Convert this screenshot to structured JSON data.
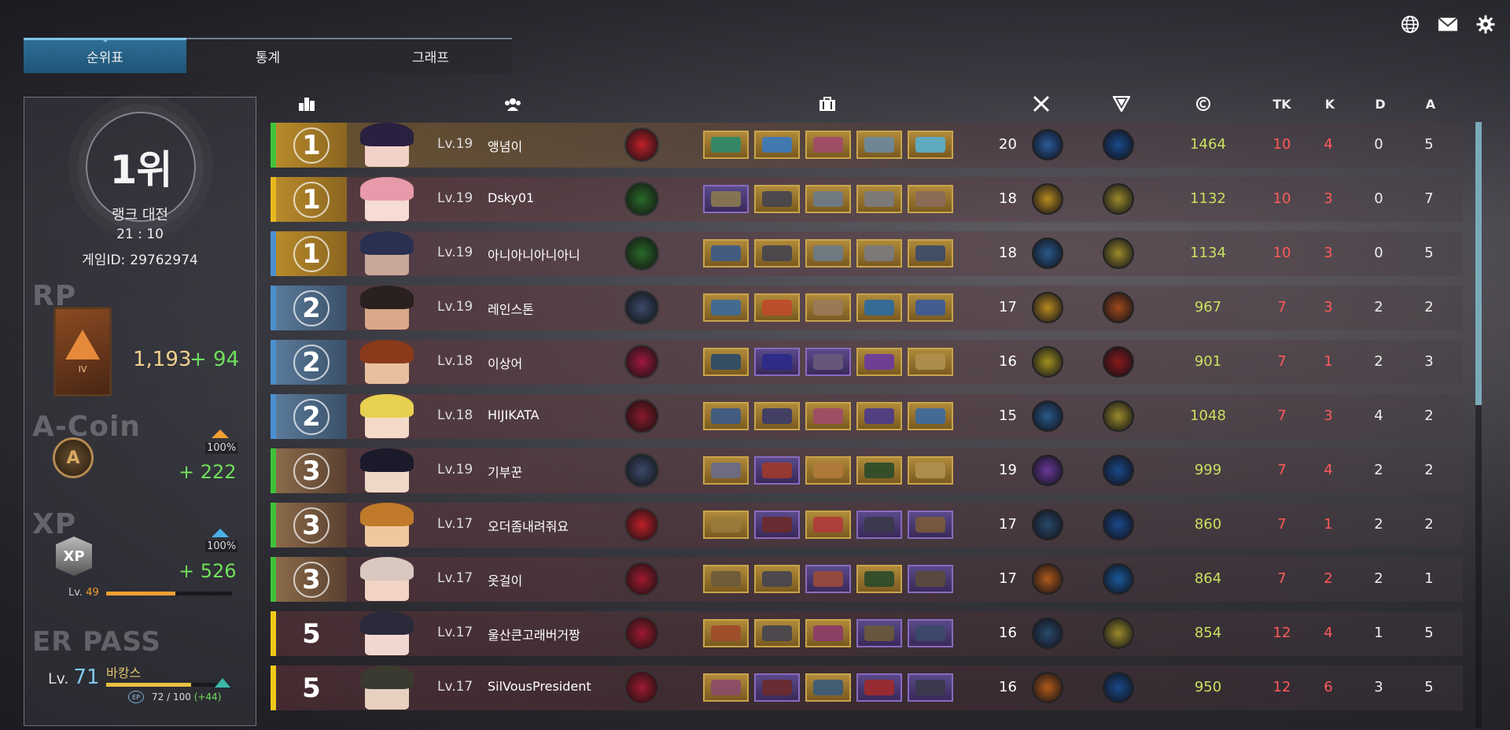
{
  "tabs": [
    {
      "label": "순위표",
      "active": true
    },
    {
      "label": "통계",
      "active": false
    },
    {
      "label": "그래프",
      "active": false
    }
  ],
  "top_icons": [
    "globe-icon",
    "mail-icon",
    "gear-icon"
  ],
  "summary": {
    "rank": "1위",
    "mode": "랭크 대전",
    "time": "21 : 10",
    "game_id_label": "게임ID:",
    "game_id": "29762974",
    "rp_label": "RP",
    "rp_tier": "IV",
    "rp_value": "1,193",
    "rp_gain": "+ 94",
    "acoin_label": "A-Coin",
    "acoin_pct": "100%",
    "acoin_gain": "+ 222",
    "xp_label": "XP",
    "xp_icon_text": "XP",
    "xp_pct": "100%",
    "xp_gain": "+ 526",
    "xp_level_prefix": "Lv.",
    "xp_level": "49",
    "xp_progress": 0.55,
    "erpass_label": "ER PASS",
    "er_level_prefix": "Lv.",
    "er_level": "71",
    "er_name": "바캉스",
    "ep_badge": "EP",
    "ep_value": "72 / 100",
    "ep_gain": "(+44)",
    "ep_progress": 0.72
  },
  "columns": [
    "rank-icon",
    "team-icon",
    "inventory-icon",
    "weapon-mastery-icon",
    "trait-icon",
    "credit-icon",
    "TK",
    "K",
    "D",
    "A"
  ],
  "colors": {
    "green": "#3fc23a",
    "gold": "#e8b820",
    "blue": "#4a90d0",
    "yellow": "#f0c81a",
    "credit": "#c9e060",
    "kill": "#ff5a5a"
  },
  "rows": [
    {
      "rank": "1",
      "stripe": "green",
      "tint": "rgba(150,110,40,0.55)",
      "level": "Lv.19",
      "name": "앵념이",
      "weapon_lv": "20",
      "credit": "1464",
      "tk": "10",
      "k": "4",
      "d": "0",
      "a": "5",
      "skill": "#c0202a",
      "weapon": "#2a5a9a",
      "trait": "#1a4a8a",
      "items": [
        "#2a8a6a",
        "#3a7ac0",
        "#a04a6a",
        "#6a8aa0",
        "#5ab0d0"
      ],
      "item_borders": [
        "#c9a44a",
        "#c9a44a",
        "#c9a44a",
        "#c9a44a",
        "#c9a44a"
      ],
      "hair": "#2a2040",
      "skin_tone": "#f2d2c8"
    },
    {
      "rank": "1",
      "stripe": "gold",
      "tint": "rgba(120,60,60,0.45)",
      "level": "Lv.19",
      "name": "Dsky01",
      "weapon_lv": "18",
      "credit": "1132",
      "tk": "10",
      "k": "3",
      "d": "0",
      "a": "7",
      "skill": "#2a6a2a",
      "weapon": "#b88a20",
      "trait": "#9a8a2a",
      "items": [
        "#8a7a50",
        "#444450",
        "#6a7a8a",
        "#7a7a80",
        "#8a6a5a"
      ],
      "item_borders": [
        "#8a6ac0",
        "#c9a44a",
        "#c9a44a",
        "#c9a44a",
        "#c9a44a"
      ],
      "hair": "#e89aaa",
      "skin_tone": "#f6dcd2"
    },
    {
      "rank": "1",
      "stripe": "blue",
      "tint": "rgba(110,60,70,0.45)",
      "level": "Lv.19",
      "name": "아니아니아니아니",
      "weapon_lv": "18",
      "credit": "1134",
      "tk": "10",
      "k": "3",
      "d": "0",
      "a": "5",
      "skill": "#2a6a2a",
      "weapon": "#2a5a8a",
      "trait": "#9a8a2a",
      "items": [
        "#3a5a8a",
        "#444450",
        "#6a7a8a",
        "#7a7a80",
        "#3a4a6a"
      ],
      "item_borders": [
        "#c9a44a",
        "#c9a44a",
        "#c9a44a",
        "#c9a44a",
        "#c9a44a"
      ],
      "hair": "#2a3050",
      "skin_tone": "#c8a898"
    },
    {
      "rank": "2",
      "stripe": "blue",
      "tint": "rgba(110,55,60,0.45)",
      "level": "Lv.19",
      "name": "레인스톤",
      "weapon_lv": "17",
      "credit": "967",
      "tk": "7",
      "k": "3",
      "d": "2",
      "a": "2",
      "skill": "#3a4a6a",
      "weapon": "#b88a20",
      "trait": "#a04a1a",
      "items": [
        "#3a6a9a",
        "#c04a2a",
        "#9a7a5a",
        "#2a6aa0",
        "#3a5a9a"
      ],
      "item_borders": [
        "#c9a44a",
        "#c9a44a",
        "#c9a44a",
        "#c9a44a",
        "#c9a44a"
      ],
      "hair": "#2a2020",
      "skin_tone": "#d8a888"
    },
    {
      "rank": "2",
      "stripe": "blue",
      "tint": "rgba(110,55,60,0.45)",
      "level": "Lv.18",
      "name": "이상어",
      "weapon_lv": "16",
      "credit": "901",
      "tk": "7",
      "k": "1",
      "d": "2",
      "a": "3",
      "skill": "#a01a40",
      "weapon": "#a09020",
      "trait": "#8a1a1a",
      "items": [
        "#2a4a6a",
        "#2a2a8a",
        "#6a5a7a",
        "#6a3aa0",
        "#b09050"
      ],
      "item_borders": [
        "#c9a44a",
        "#8a6ac0",
        "#8a6ac0",
        "#c9a44a",
        "#c9a44a"
      ],
      "hair": "#8a3a1a",
      "skin_tone": "#e8c0a0"
    },
    {
      "rank": "2",
      "stripe": "blue",
      "tint": "rgba(110,55,60,0.45)",
      "level": "Lv.18",
      "name": "HIJIKATA",
      "weapon_lv": "15",
      "credit": "1048",
      "tk": "7",
      "k": "3",
      "d": "4",
      "a": "2",
      "skill": "#8a1a2a",
      "weapon": "#2a5a8a",
      "trait": "#9a8a2a",
      "items": [
        "#3a5a8a",
        "#3a3a6a",
        "#a04a6a",
        "#4a3a8a",
        "#3a6aa0"
      ],
      "item_borders": [
        "#c9a44a",
        "#c9a44a",
        "#c9a44a",
        "#c9a44a",
        "#c9a44a"
      ],
      "hair": "#e8d050",
      "skin_tone": "#f4dac8"
    },
    {
      "rank": "3",
      "stripe": "green",
      "tint": "rgba(110,55,60,0.45)",
      "level": "Lv.19",
      "name": "기부꾼",
      "weapon_lv": "19",
      "credit": "999",
      "tk": "7",
      "k": "4",
      "d": "2",
      "a": "2",
      "skill": "#3a4a6a",
      "weapon": "#6a3a9a",
      "trait": "#1a4a8a",
      "items": [
        "#6a6a8a",
        "#a03a2a",
        "#b07a3a",
        "#2a4a2a",
        "#b09050"
      ],
      "item_borders": [
        "#c9a44a",
        "#8a6ac0",
        "#c9a44a",
        "#c9a44a",
        "#c9a44a"
      ],
      "hair": "#1a1a2a",
      "skin_tone": "#f0d8c8"
    },
    {
      "rank": "3",
      "stripe": "green",
      "tint": "rgba(110,55,60,0.45)",
      "level": "Lv.17",
      "name": "오더좀내려줘요",
      "weapon_lv": "17",
      "credit": "860",
      "tk": "7",
      "k": "1",
      "d": "2",
      "a": "2",
      "skill": "#c0202a",
      "weapon": "#2a4a6a",
      "trait": "#1a4a8a",
      "items": [
        "#9a7a3a",
        "#6a2a2a",
        "#b03a3a",
        "#3a3a4a",
        "#7a5a3a"
      ],
      "item_borders": [
        "#c9a44a",
        "#8a6ac0",
        "#c9a44a",
        "#8a6ac0",
        "#8a6ac0"
      ],
      "hair": "#c07a2a",
      "skin_tone": "#f0c8a0"
    },
    {
      "rank": "3",
      "stripe": "green",
      "tint": "rgba(110,55,60,0.45)",
      "level": "Lv.17",
      "name": "옷걸이",
      "weapon_lv": "17",
      "credit": "864",
      "tk": "7",
      "k": "2",
      "d": "2",
      "a": "1",
      "skill": "#a01a30",
      "weapon": "#b05a1a",
      "trait": "#1a5a9a",
      "items": [
        "#6a5a3a",
        "#444450",
        "#9a4a3a",
        "#2a4a2a",
        "#5a4a3a"
      ],
      "item_borders": [
        "#c9a44a",
        "#c9a44a",
        "#8a6ac0",
        "#c9a44a",
        "#8a6ac0"
      ],
      "hair": "#d8c8c0",
      "skin_tone": "#f2d4c4"
    },
    {
      "rank": "5",
      "stripe": "yellow",
      "tint": "rgba(110,55,60,0.45)",
      "level": "Lv.17",
      "name": "울산큰고래버거짱",
      "weapon_lv": "16",
      "credit": "854",
      "tk": "12",
      "k": "4",
      "d": "1",
      "a": "5",
      "skill": "#a01a30",
      "weapon": "#2a4a6a",
      "trait": "#9a8a2a",
      "items": [
        "#a04a2a",
        "#444450",
        "#8a3a6a",
        "#6a5a3a",
        "#3a4a6a"
      ],
      "item_borders": [
        "#c9a44a",
        "#c9a44a",
        "#c9a44a",
        "#8a6ac0",
        "#8a6ac0"
      ],
      "hair": "#2a2a3a",
      "skin_tone": "#f0d8d0"
    },
    {
      "rank": "5",
      "stripe": "yellow",
      "tint": "rgba(110,55,60,0.45)",
      "level": "Lv.17",
      "name": "SilVousPresident",
      "weapon_lv": "16",
      "credit": "950",
      "tk": "12",
      "k": "6",
      "d": "3",
      "a": "5",
      "skill": "#a01a30",
      "weapon": "#b05a1a",
      "trait": "#1a4a8a",
      "items": [
        "#8a4a6a",
        "#6a2a2a",
        "#3a5a7a",
        "#a02a2a",
        "#3a3a4a"
      ],
      "item_borders": [
        "#c9a44a",
        "#8a6ac0",
        "#c9a44a",
        "#8a6ac0",
        "#8a6ac0"
      ],
      "hair": "#3a3a30",
      "skin_tone": "#e8d0c0"
    }
  ]
}
